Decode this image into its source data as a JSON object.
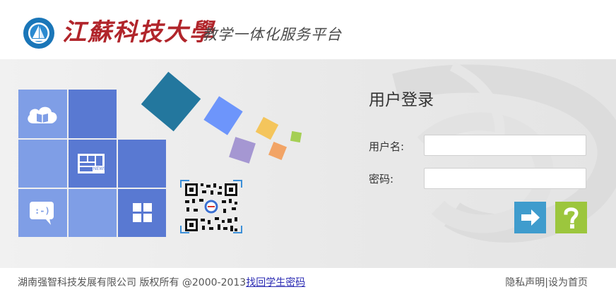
{
  "header": {
    "school_calligraphy": "江蘇科技大學",
    "portal_name": "教学一体化服务平台",
    "seal_text": "JIANGSU UNIVERSITY OF SCIENCE AND TECHNOLOGY"
  },
  "tiles": {
    "cloud_book_icon": "cloud-book-icon",
    "news_icon": "news-icon",
    "news_text": "NEWS",
    "chat_icon": "chat-icon",
    "chat_text": ":-)",
    "apps_icon": "apps-grid-icon"
  },
  "login": {
    "title": "用户登录",
    "username_label": "用户名:",
    "username_value": "",
    "password_label": "密码:",
    "password_value": "",
    "submit_icon": "arrow-right-icon",
    "help_icon": "question-icon"
  },
  "footer": {
    "copyright": "湖南强智科技发展有限公司 版权所有 @2000-2013",
    "recover_link": "找回学生密码",
    "privacy": "隐私声明",
    "separator": "|",
    "set_homepage": "设为首页"
  },
  "colors": {
    "tile_dark": "#5979d2",
    "tile_light": "#7f9ee6",
    "submit_button": "#3f9ccd",
    "help_button": "#9cc63d",
    "brand_red": "#b1252b"
  }
}
